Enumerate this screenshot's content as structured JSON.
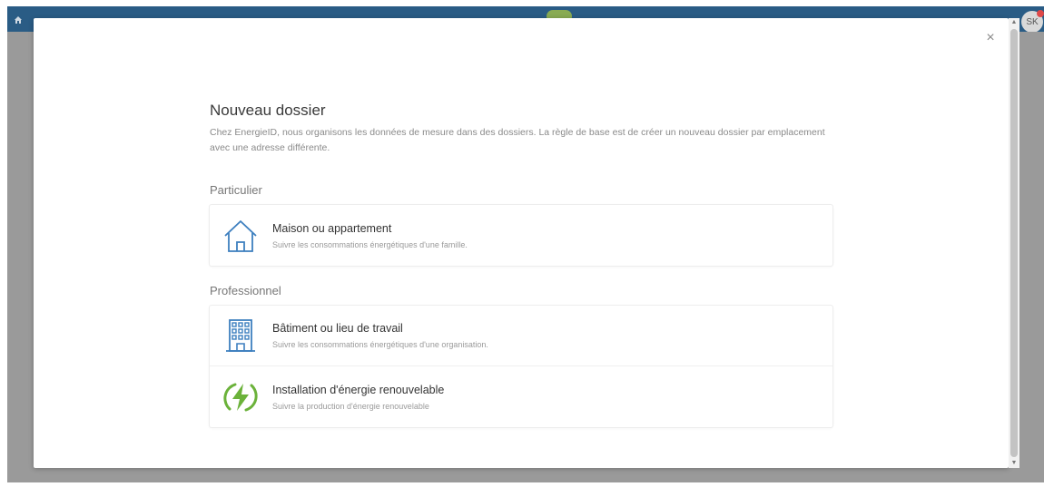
{
  "topbar": {
    "avatar_initials": "SK",
    "home_icon": "home-icon"
  },
  "modal": {
    "close_label": "×",
    "title": "Nouveau dossier",
    "description": "Chez EnergieID, nous organisons les données de mesure dans des dossiers. La règle de base est de créer un nouveau dossier par emplacement avec une adresse différente.",
    "sections": [
      {
        "title": "Particulier",
        "items": [
          {
            "title": "Maison ou appartement",
            "subtitle": "Suivre les consommations énergétiques d'une famille.",
            "icon": "house-icon"
          }
        ]
      },
      {
        "title": "Professionnel",
        "items": [
          {
            "title": "Bâtiment ou lieu de travail",
            "subtitle": "Suivre les consommations énergétiques d'une organisation.",
            "icon": "building-icon"
          },
          {
            "title": "Installation d'énergie renouvelable",
            "subtitle": "Suivre la production d'énergie renouvelable",
            "icon": "lightning-icon"
          }
        ]
      }
    ]
  },
  "colors": {
    "topbar": "#2a5c85",
    "backdrop": "#9a9a9a",
    "icon_blue": "#3d7fbf",
    "icon_green": "#6bb23a"
  }
}
